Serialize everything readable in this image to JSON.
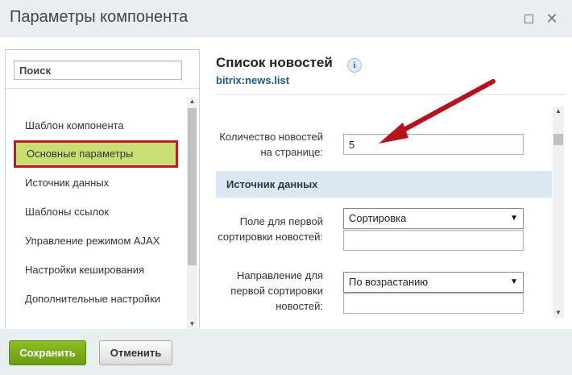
{
  "dialog": {
    "title": "Параметры компонента"
  },
  "sidebar": {
    "search_placeholder": "Поиск",
    "items": [
      {
        "label": "Шаблон компонента"
      },
      {
        "label": "Основные параметры"
      },
      {
        "label": "Источник данных"
      },
      {
        "label": "Шаблоны ссылок"
      },
      {
        "label": "Управление режимом AJAX"
      },
      {
        "label": "Настройки кеширования"
      },
      {
        "label": "Дополнительные настройки"
      }
    ]
  },
  "component": {
    "title": "Список новостей",
    "code": "bitrix:news.list"
  },
  "fields": {
    "news_count": {
      "label": "Количество новостей на странице:",
      "value": "5"
    },
    "section_title": "Источник данных",
    "sort_by1": {
      "label": "Поле для первой сортировки новостей:",
      "value": "Сортировка"
    },
    "sort_order1": {
      "label": "Направление для первой сортировки новостей:",
      "value": "По возрастанию"
    }
  },
  "footer": {
    "save_label": "Сохранить",
    "cancel_label": "Отменить"
  },
  "colors": {
    "active_item_bg": "#c9df74",
    "active_item_border": "#b21e2a",
    "annotation_arrow": "#b5141e",
    "save_button": "#7aab1a",
    "section_header_bg": "#dbe8f4"
  }
}
